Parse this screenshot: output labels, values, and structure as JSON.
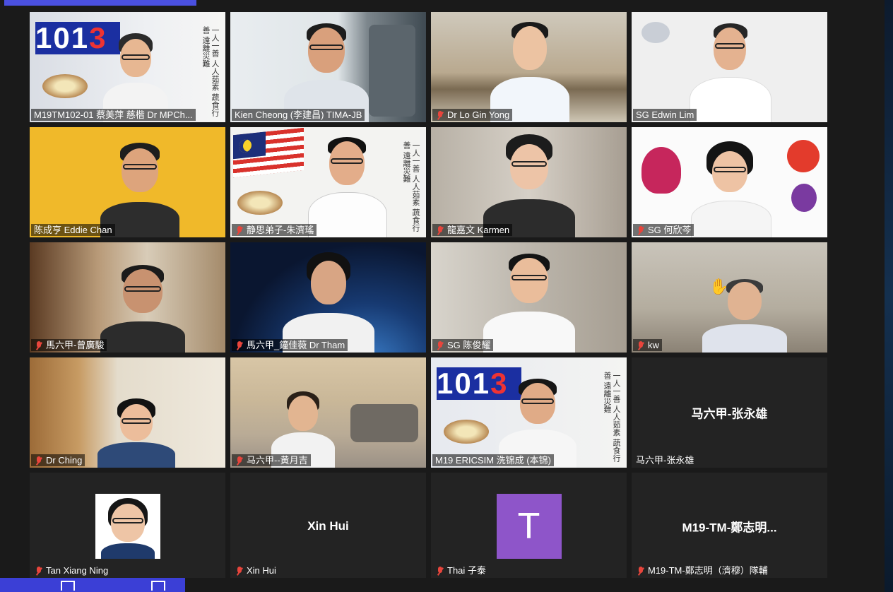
{
  "app": {
    "accent": "#4a50e0",
    "active_speaker_color": "#b7e36b",
    "muted_icon": "muted-mic-icon"
  },
  "participants": [
    {
      "name": "M19TM102-01 蔡美萍 慈楷 Dr MPCh...",
      "muted": false
    },
    {
      "name": "Kien Cheong (李建昌) TIMA-JB",
      "muted": false,
      "active": true
    },
    {
      "name": "Dr Lo Gin Yong",
      "muted": true
    },
    {
      "name": "SG Edwin Lim",
      "muted": false
    },
    {
      "name": "陈成亨 Eddie Chan",
      "muted": false
    },
    {
      "name": "静思弟子-朱濟瑤",
      "muted": true
    },
    {
      "name": "龍嘉文 Karmen",
      "muted": true
    },
    {
      "name": "SG 何欣芩",
      "muted": true
    },
    {
      "name": "馬六甲-曾廣駿",
      "muted": true
    },
    {
      "name": "馬六甲_鐘佳薇 Dr Tham",
      "muted": true
    },
    {
      "name": "SG 陈俊耀",
      "muted": true
    },
    {
      "name": "kw",
      "muted": true
    },
    {
      "name": "Dr Ching",
      "muted": true
    },
    {
      "name": "马六甲--黄月吉",
      "muted": true
    },
    {
      "name": "M19 ERICSIM 洗锦成 (本锦)",
      "muted": false
    },
    {
      "name": "马六甲-张永雄",
      "muted": false,
      "center_label": "马六甲-张永雄"
    },
    {
      "name": "Tan Xiang Ning",
      "muted": true
    },
    {
      "name": "Xin Hui",
      "muted": true,
      "center_label": "Xin Hui"
    },
    {
      "name": "Thai 子泰",
      "muted": true,
      "avatar_letter": "T"
    },
    {
      "name": "M19-TM-鄭志明（濟穆）隊輔",
      "muted": true,
      "center_label": "M19-TM-鄭志明..."
    }
  ],
  "decor": {
    "logo_text_a": "101",
    "logo_text_b": "3",
    "calligraphy": "一人一善 人人茹素 蔬食行善 遠離災難"
  }
}
